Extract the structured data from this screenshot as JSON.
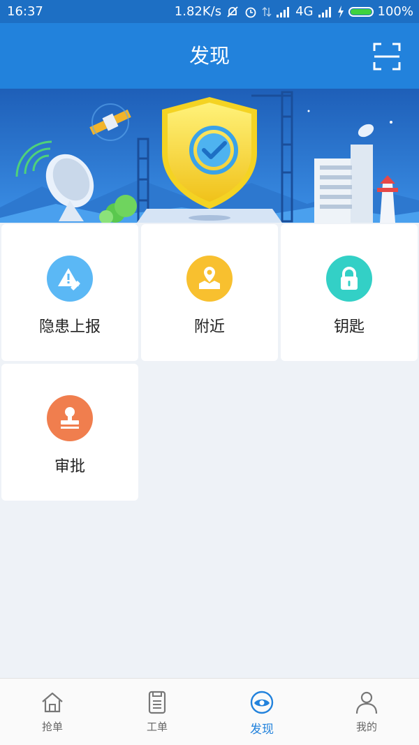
{
  "status_bar": {
    "time": "16:37",
    "speed": "1.82K/s",
    "network": "4G",
    "battery": "100%"
  },
  "header": {
    "title": "发现",
    "scan_icon": "scan-icon"
  },
  "features": [
    {
      "label": "隐患上报",
      "icon": "hazard-report-icon",
      "color": "#5bb8f5"
    },
    {
      "label": "附近",
      "icon": "location-map-icon",
      "color": "#f8c02f"
    },
    {
      "label": "钥匙",
      "icon": "lock-icon",
      "color": "#33d0c6"
    },
    {
      "label": "审批",
      "icon": "stamp-icon",
      "color": "#f07e4e"
    }
  ],
  "tabs": [
    {
      "label": "抢单",
      "icon": "home-icon"
    },
    {
      "label": "工单",
      "icon": "document-icon"
    },
    {
      "label": "发现",
      "icon": "discover-eye-icon",
      "active": true
    },
    {
      "label": "我的",
      "icon": "user-icon"
    }
  ],
  "colors": {
    "primary": "#2282dc",
    "status_bar": "#1d6fc4",
    "background": "#eef2f7"
  }
}
